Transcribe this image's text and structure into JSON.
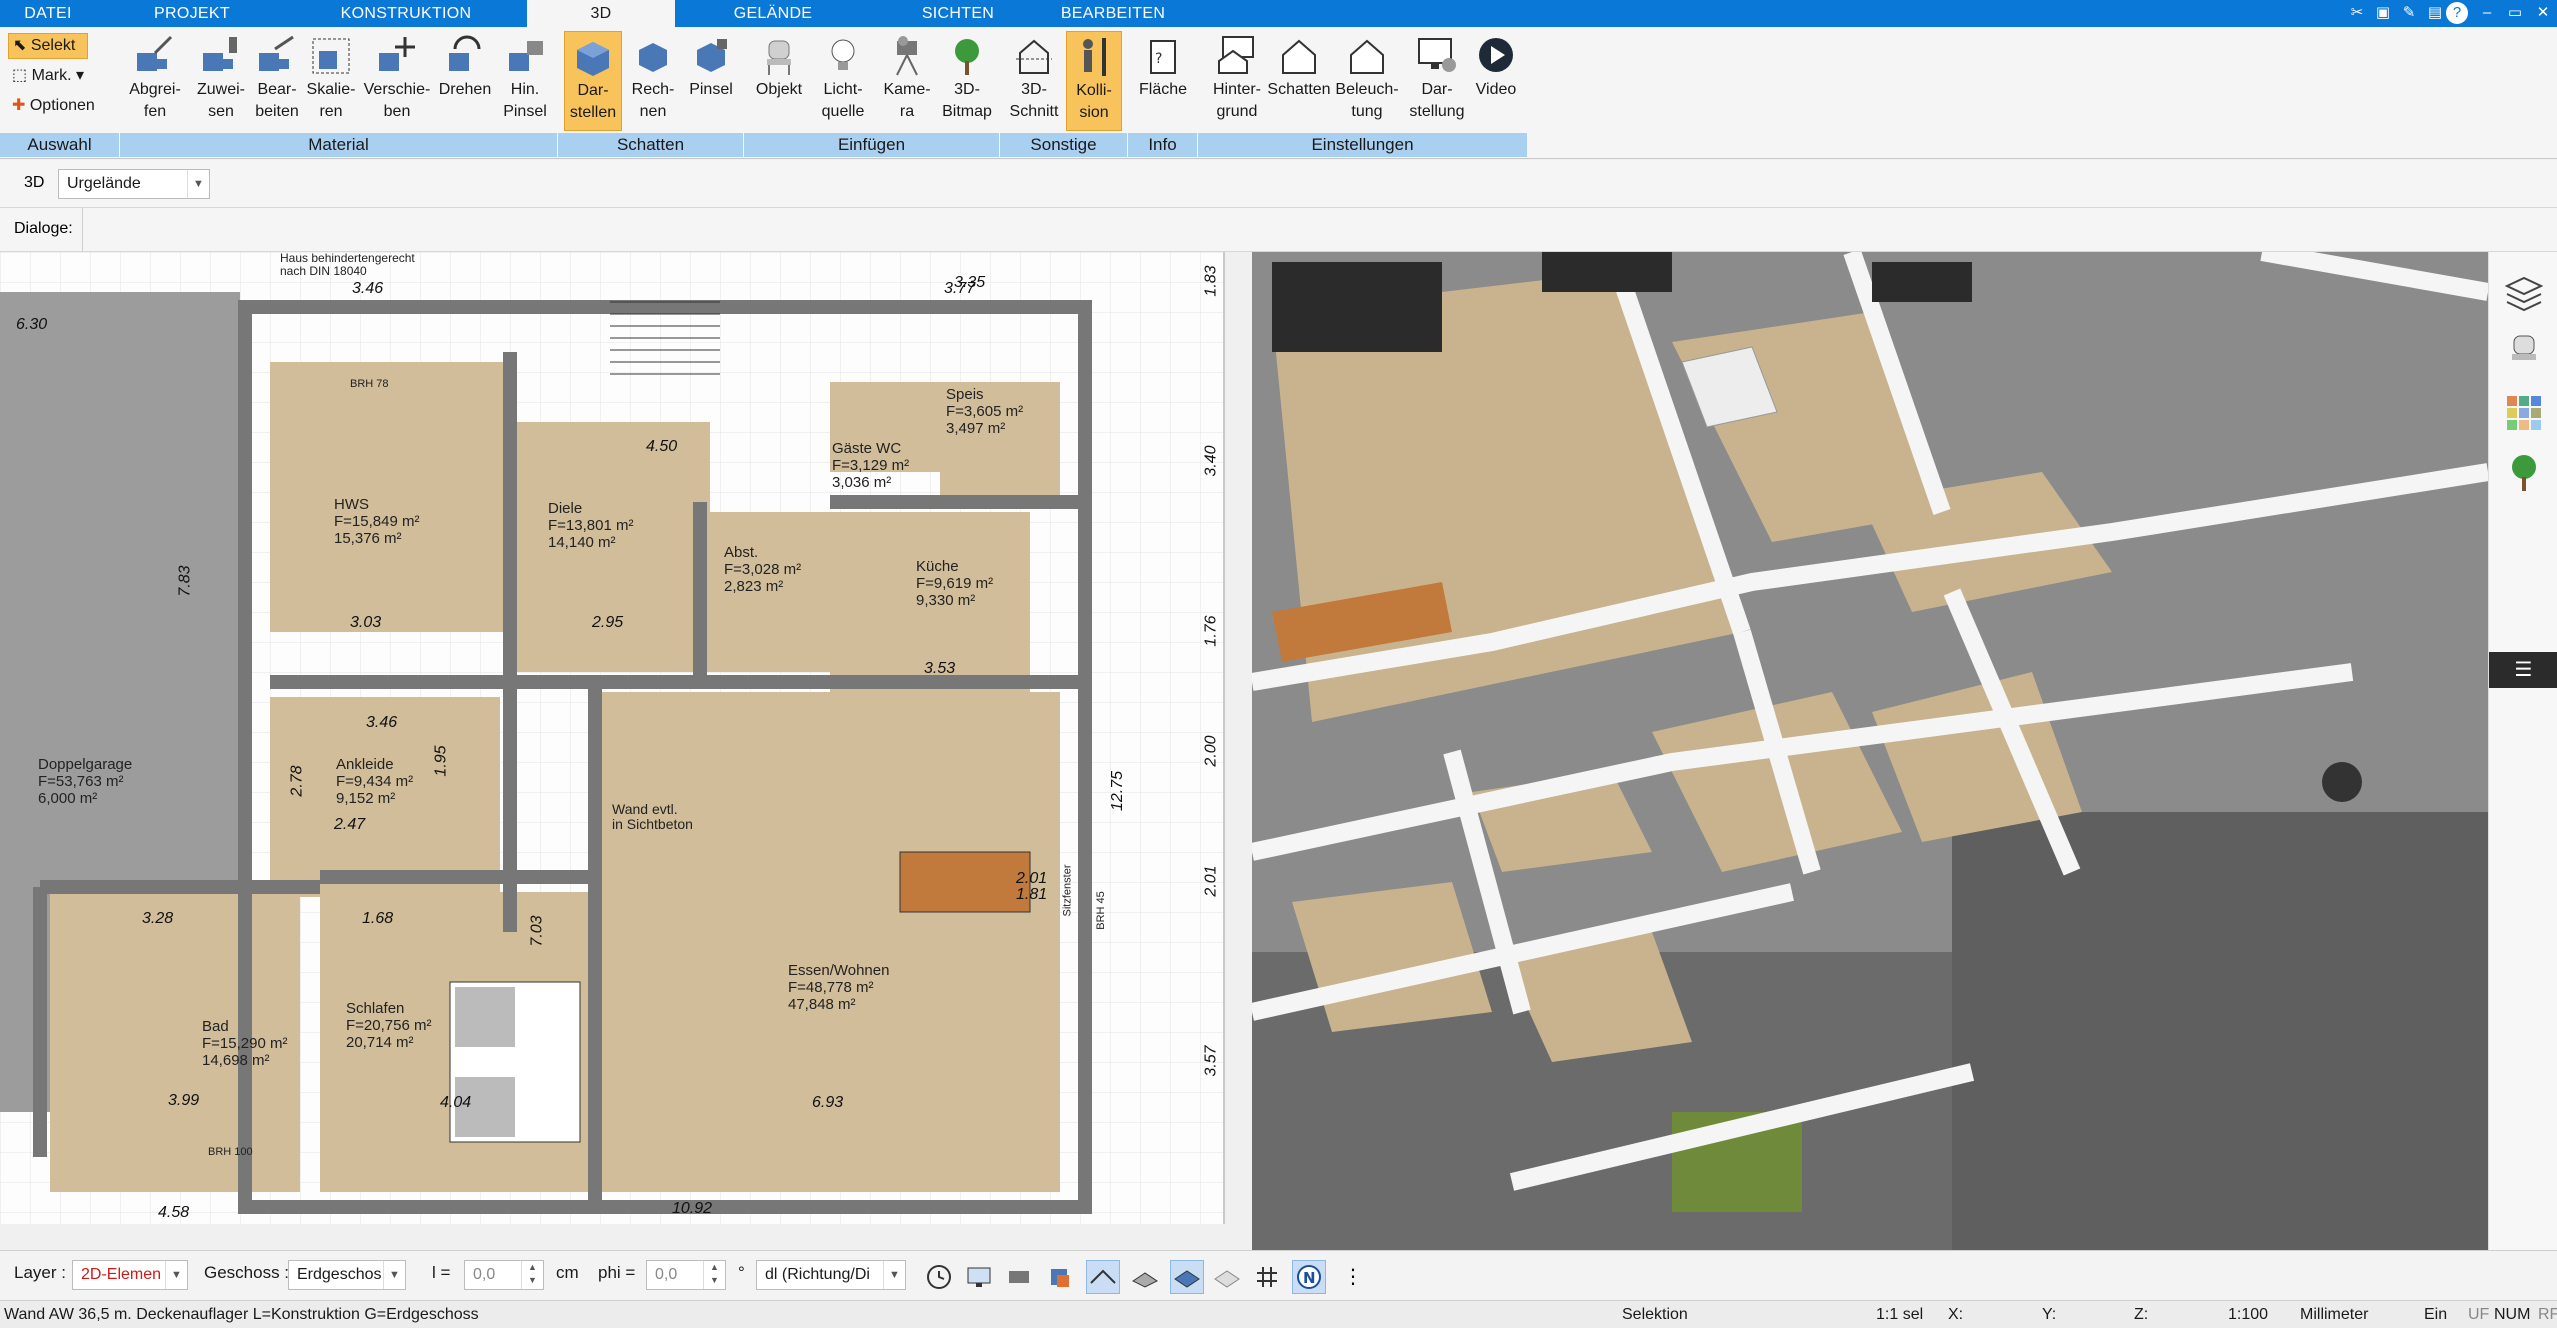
{
  "tabs": [
    {
      "label": "DATEI",
      "active": false
    },
    {
      "label": "PROJEKT",
      "active": false
    },
    {
      "label": "KONSTRUKTION",
      "active": false
    },
    {
      "label": "3D",
      "active": true
    },
    {
      "label": "GELÄNDE",
      "active": false
    },
    {
      "label": "SICHTEN",
      "active": false
    },
    {
      "label": "BEARBEITEN",
      "active": false
    }
  ],
  "selection_tools": {
    "selekt": "Selekt",
    "mark": "Mark.",
    "optionen": "Optionen"
  },
  "ribbon_buttons": {
    "abgreifen": "Abgrei-\nfen",
    "zuweisen": "Zuwei-\nsen",
    "bearbeiten": "Bear-\nbeiten",
    "skalieren": "Skalie-\nren",
    "verschieben": "Verschie-\nben",
    "drehen": "Drehen",
    "hin_pinsel": "Hin.\nPinsel",
    "darstellen": "Dar-\nstellen",
    "rechnen": "Rech-\nnen",
    "pinsel": "Pinsel",
    "objekt": "Objekt",
    "lichtquelle": "Licht-\nquelle",
    "kamera": "Kame-\nra",
    "bitmap_3d": "3D-\nBitmap",
    "schnitt_3d": "3D-\nSchnitt",
    "kollision": "Kolli-\nsion",
    "flaeche": "Fläche",
    "hintergrund": "Hinter-\ngrund",
    "schatten2": "Schatten",
    "beleuchtung": "Beleuch-\ntung",
    "darstellung": "Dar-\nstellung",
    "video": "Video"
  },
  "ribbon_groups": {
    "auswahl": "Auswahl",
    "material": "Material",
    "schatten": "Schatten",
    "einfuegen": "Einfügen",
    "sonstige": "Sonstige",
    "info": "Info",
    "einstellungen": "Einstellungen"
  },
  "option_row": {
    "mode_label": "3D",
    "terrain_select": "Urgelände",
    "dialoge_label": "Dialoge:"
  },
  "plan": {
    "rooms": [
      {
        "name": "HWS",
        "area1": "F=15,849 m²",
        "area2": "15,376 m²"
      },
      {
        "name": "Diele",
        "area1": "F=13,801 m²",
        "area2": "14,140 m²"
      },
      {
        "name": "Küche",
        "area1": "F=9,619 m²",
        "area2": "9,330 m²"
      },
      {
        "name": "Abst.",
        "area1": "F=3,028 m²",
        "area2": "2,823 m²"
      },
      {
        "name": "Gäste WC",
        "area1": "F=3,129 m²",
        "area2": "3,036 m²"
      },
      {
        "name": "Speis",
        "area1": "F=3,605 m²",
        "area2": "3,497 m²"
      },
      {
        "name": "Ankleide",
        "area1": "F=9,434 m²",
        "area2": "9,152 m²"
      },
      {
        "name": "Doppelgarage",
        "area1": "F=53,763 m²",
        "area2": "6,000 m²"
      },
      {
        "name": "Bad",
        "area1": "F=15,290 m²",
        "area2": "14,698 m²"
      },
      {
        "name": "Schlafen",
        "area1": "F=20,756 m²",
        "area2": "20,714 m²"
      },
      {
        "name": "Essen/Wohnen",
        "area1": "F=48,778 m²",
        "area2": "47,848 m²"
      }
    ],
    "dimensions": [
      "3.46",
      "3.77",
      "6.30",
      "4.50",
      "3.03",
      "2.95",
      "3.53",
      "3.46",
      "2.47",
      "1.68",
      "4.04",
      "6.93",
      "10.92",
      "4.58",
      "3.99",
      "1.83",
      "3.40",
      "1.76",
      "2.00",
      "2.01",
      "3.57",
      "12.75",
      "7.83",
      "7.03",
      "2.78",
      "1.95",
      "3.28",
      "3.35",
      "2.01",
      "1.81"
    ],
    "notes": [
      "Haus behindertengerecht",
      "nach DIN 18040",
      "Wand evtl.",
      "in Sichtbeton",
      "BRH 78",
      "BRH 100",
      "BRH 45",
      "Sitzfenster"
    ]
  },
  "bottom_toolbar": {
    "layer_label": "Layer :",
    "layer_value": "2D-Elemen",
    "geschoss_label": "Geschoss :",
    "geschoss_value": "Erdgeschos",
    "l_label": "l =",
    "l_value": "0,0",
    "unit": "cm",
    "phi_label": "phi =",
    "phi_value": "0,0",
    "deg": "°",
    "dl_value": "dl (Richtung/Di"
  },
  "status": {
    "message": "Wand AW 36,5 m. Deckenauflager L=Konstruktion G=Erdgeschoss",
    "mode": "Selektion",
    "sel": "1:1 sel",
    "x": "X:",
    "y": "Y:",
    "z": "Z:",
    "scale": "1:100",
    "unit": "Millimeter",
    "ein": "Ein",
    "uf": "UF",
    "num": "NUM",
    "rf": "RF"
  },
  "colors": {
    "accent_blue": "#0a78d7",
    "group_blue": "#a9cff1",
    "selected_orange": "#f7c35a",
    "wood_floor": "#cdb490",
    "wall_gray": "#8f8f8f"
  }
}
